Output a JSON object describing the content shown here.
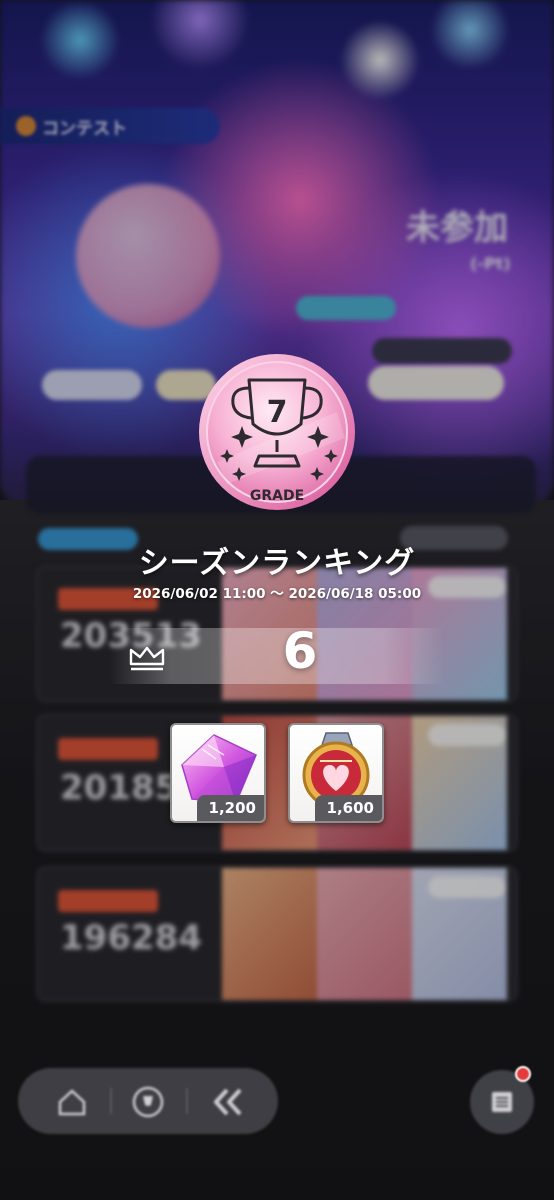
{
  "background": {
    "contest_label": "コンテスト",
    "status_label": "未参加",
    "status_sub": "(-Pt)",
    "cards": [
      {
        "score": "203513"
      },
      {
        "score": "201850"
      },
      {
        "score": "196284"
      }
    ]
  },
  "badge": {
    "grade_number": "7",
    "grade_label": "GRADE"
  },
  "season": {
    "title": "シーズンランキング",
    "period": "2026/06/02 11:00 ～ 2026/06/18 05:00",
    "rank": "6"
  },
  "rewards": [
    {
      "icon": "gem-icon",
      "count": "1,200"
    },
    {
      "icon": "medal-icon",
      "count": "1,600"
    }
  ],
  "nav": {
    "items": [
      "home-icon",
      "trophy-icon",
      "back-icon"
    ],
    "menu": "menu-icon"
  },
  "colors": {
    "badge_pink": "#f3a3cc",
    "accent_red": "#e2573a",
    "panel_dark": "#2a2a30"
  }
}
